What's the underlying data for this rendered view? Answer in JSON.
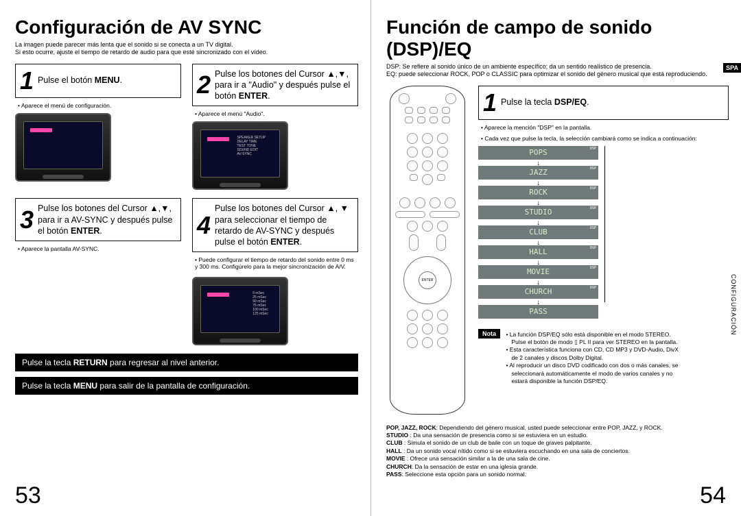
{
  "left": {
    "title": "Configuración de AV SYNC",
    "sub1": "La imagen puede parecer más lenta que el sonido si se conecta a un TV digital.",
    "sub2": "Si esto ocurre, ajuste el tiempo de retardo de audio para que esté sincronizado con el vídeo.",
    "step1": "Pulse el botón MENU.",
    "step1_bullet": "Aparece el menú de configuración.",
    "step2": "Pulse los botones del Cursor ▲,▼, para ir a \"Audio\" y después pulse el botón ENTER.",
    "step2_bullet": "Aparece el menú \"Audio\".",
    "step3": "Pulse los botones del Cursor ▲,▼, para ir a AV-SYNC y después pulse el botón ENTER.",
    "step3_bullet": "Aparece la pantalla AV-SYNC.",
    "step4": "Pulse los botones del Cursor ▲, ▼ para seleccionar el tiempo de retardo de AV-SYNC y después pulse el botón ENTER.",
    "step4_bullet": "Puede configurar el tiempo de retardo del sonido entre 0 ms y 300 ms. Configúrelo para la mejor sincronización de A/V.",
    "strip1": "Pulse la tecla RETURN para regresar al nivel anterior.",
    "strip2": "Pulse la tecla MENU para salir de la pantalla de configuración.",
    "pnum": "53"
  },
  "right": {
    "title": "Función de campo de sonido (DSP)/EQ",
    "sub1": "DSP: Se refiere al sonido único de un ambiente específico; da un sentido realístico de presencia.",
    "sub2": "EQ: puede seleccionar ROCK, POP o CLASSIC para optimizar el sonido del género musical que está reproduciendo.",
    "spa": "SPA",
    "side_tab": "CONFIGURACIÓN",
    "step1": "Pulse la tecla DSP/EQ.",
    "step1_b1": "Aparece la mención \"DSP\" en la pantalla.",
    "step1_b2": "Cada vez que pulse la tecla, la selección cambiará como se indica a continuación:",
    "modes": [
      "POPS",
      "JAZZ",
      "ROCK",
      "STUDIO",
      "CLUB",
      "HALL",
      "MOVIE",
      "CHURCH",
      "PASS"
    ],
    "dsp_label": "DSP",
    "nota": "Nota",
    "notes": [
      "La función DSP/EQ sólo está disponible en el modo STEREO. Pulse el botón de modo ▯ PL II para ver STEREO en la pantalla.",
      "Esta característica funciona con CD, CD MP3 y DVD-Audio, DivX de 2 canales y discos Dolby Digital.",
      "Al reproducir un disco DVD codificado con dos o más canales, se seleccionará automáticamente el modo de varios canales y no estará disponible la función DSP/EQ."
    ],
    "desc": [
      "POP, JAZZ, ROCK: Dependiendo del género musical, usted puede seleccionar entre POP, JAZZ, y ROCK.",
      "STUDIO : Da una sensación de presencia como si se estuviera en un estudio.",
      "CLUB : Simula el sonido de un club de baile con un toque de graves palpitante.",
      "HALL : Da un sonido vocal nítido como si se estuviera escuchando en una sala de conciertos.",
      "MOVIE : Ofrece una sensación similar a la de una sala de cine.",
      "CHURCH: Da la sensación de estar en una iglesia grande.",
      "PASS: Seleccione esta opción para un sonido normal."
    ],
    "pnum": "54"
  }
}
